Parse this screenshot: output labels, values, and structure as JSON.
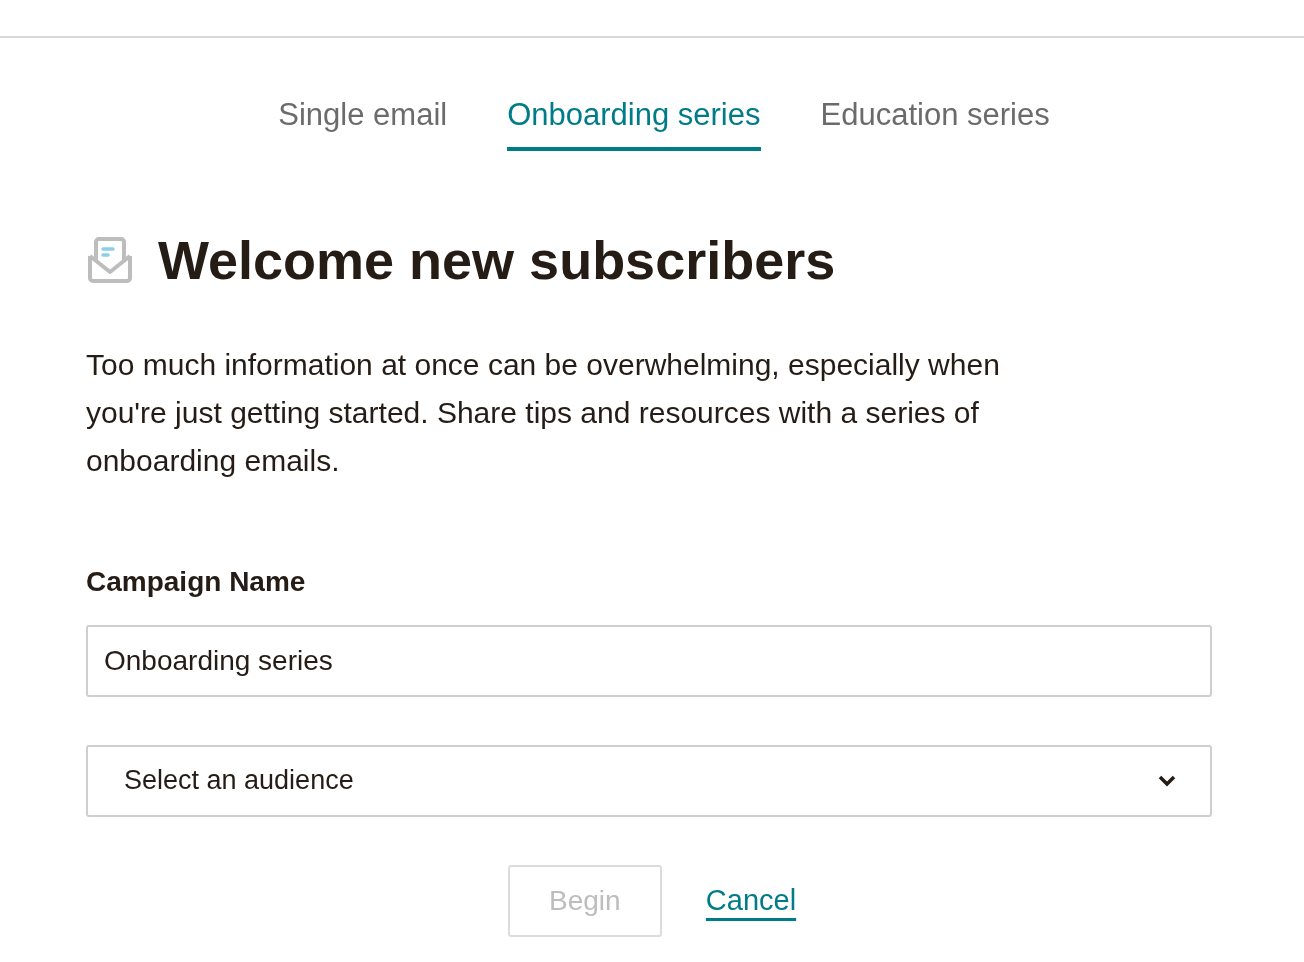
{
  "tabs": [
    {
      "label": "Single email",
      "selected": false
    },
    {
      "label": "Onboarding series",
      "selected": true
    },
    {
      "label": "Education series",
      "selected": false
    }
  ],
  "heading": "Welcome new subscribers",
  "description": "Too much information at once can be overwhelming, especially when you're just getting started. Share tips and resources with a series of onboarding emails.",
  "campaign_name": {
    "label": "Campaign Name",
    "value": "Onboarding series"
  },
  "audience_select": {
    "placeholder": "Select an audience"
  },
  "begin_button": {
    "label": "Begin",
    "disabled": true
  },
  "cancel_link": "Cancel"
}
